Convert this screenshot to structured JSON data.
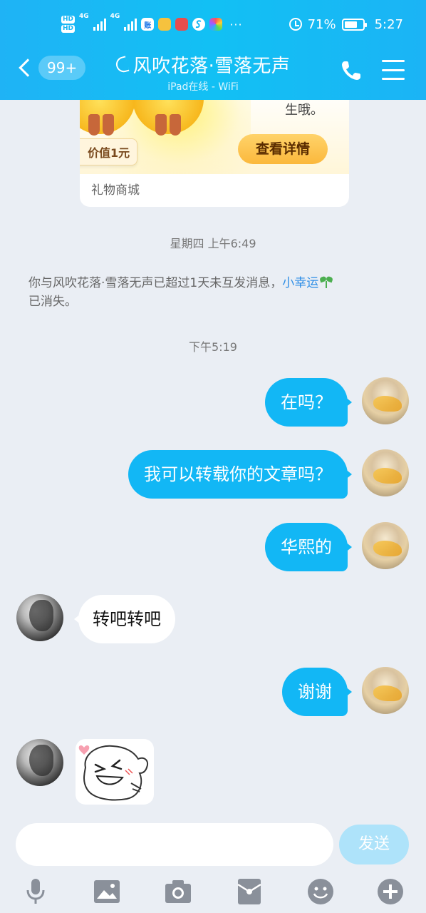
{
  "status_bar": {
    "hd1": "HD",
    "hd2": "HD",
    "sim1": "1",
    "sim2": "2",
    "net1": "4G",
    "net2": "4G",
    "app1": "账",
    "battery_percent": "71%",
    "battery_level": 0.71,
    "time": "5:27",
    "more": "···"
  },
  "header": {
    "unread_count": "99+",
    "title": "风吹花落·雪落无声",
    "subtitle": "iPad在线 - WiFi"
  },
  "gift_card": {
    "price_tag": "价值1元",
    "desc_tail": "生哦。",
    "button": "查看详情",
    "footer": "礼物商城"
  },
  "timestamps": {
    "first": "星期四 上午6:49",
    "second": "下午5:19"
  },
  "system_notice": {
    "before": "你与风吹花落·雪落无声已超过1天未互发消息，",
    "link": "小幸运",
    "after": "已消失。"
  },
  "messages": [
    {
      "side": "out",
      "text": "在吗？"
    },
    {
      "side": "out",
      "text": "我可以转载你的文章吗？"
    },
    {
      "side": "out",
      "text": "华熙的"
    },
    {
      "side": "in",
      "text": "转吧转吧"
    },
    {
      "side": "out",
      "text": "谢谢"
    },
    {
      "side": "in",
      "type": "sticker"
    }
  ],
  "input": {
    "value": "",
    "send": "发送"
  },
  "toolbar": [
    "mic-icon",
    "image-icon",
    "camera-icon",
    "red-packet-icon",
    "emoji-icon",
    "plus-icon"
  ],
  "colors": {
    "header": "#12c0f4",
    "bubble_out": "#12b7f5",
    "link": "#2e8ee6",
    "send_disabled": "#aee3fa"
  }
}
